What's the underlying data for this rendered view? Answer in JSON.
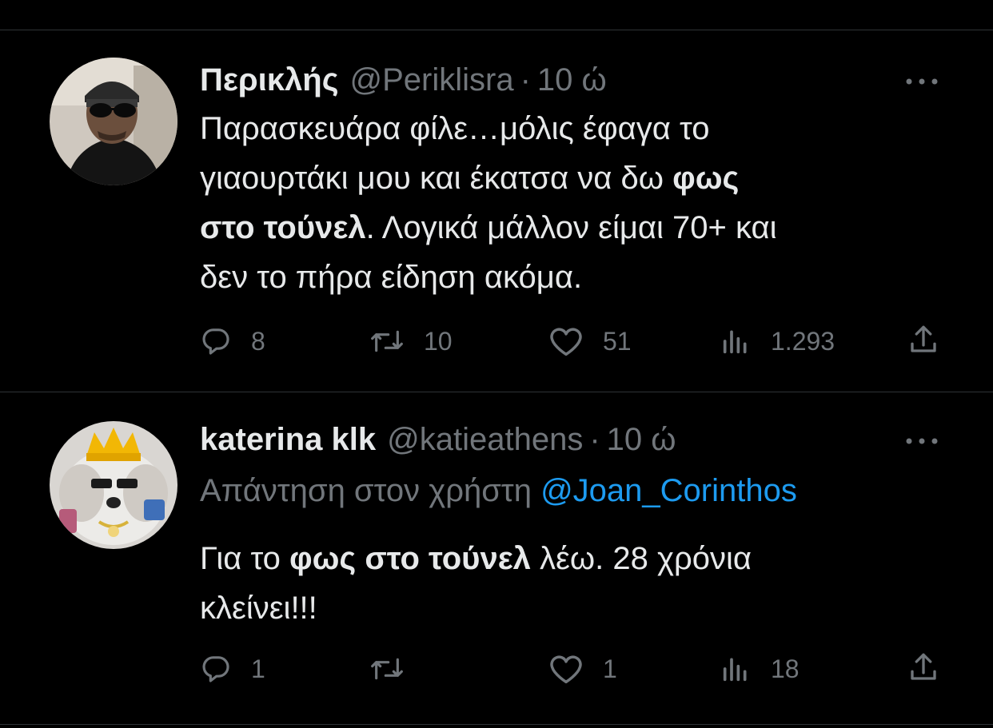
{
  "tweets": [
    {
      "name": "Περικλής",
      "handle": "@Periklisra",
      "dot": "·",
      "time": "10 ώ",
      "body": {
        "line1": "Παρασκευάρα φίλε…μόλις έφαγα το",
        "line2_pre": "γιαουρτάκι μου και έκατσα να δω ",
        "line2_bold": "φως",
        "line3_bold": "στο τούνελ",
        "line3_post": ". Λογικά μάλλον είμαι 70+ και",
        "line4": "δεν το πήρα είδηση ακόμα."
      },
      "stats": {
        "replies": "8",
        "retweets": "10",
        "likes": "51",
        "views": "1.293"
      }
    },
    {
      "name": "katerina klk",
      "handle": "@katieathens",
      "dot": "·",
      "time": "10 ώ",
      "reply_prefix": "Απάντηση στον χρήστη ",
      "reply_mention": "@Joan_Corinthos",
      "body": {
        "line1_pre": "Για το ",
        "line1_bold": "φως στο τούνελ",
        "line1_post": " λέω. 28 χρόνια",
        "line2": "κλείνει!!!"
      },
      "stats": {
        "replies": "1",
        "retweets": "",
        "likes": "1",
        "views": "18"
      }
    }
  ],
  "colors": {
    "background": "#000000",
    "text": "#e7e9ea",
    "muted": "#71767b",
    "link": "#1d9bf0",
    "divider": "#2f3336"
  },
  "icons": [
    "reply-icon",
    "retweet-icon",
    "like-icon",
    "views-icon",
    "share-icon",
    "more-icon"
  ]
}
